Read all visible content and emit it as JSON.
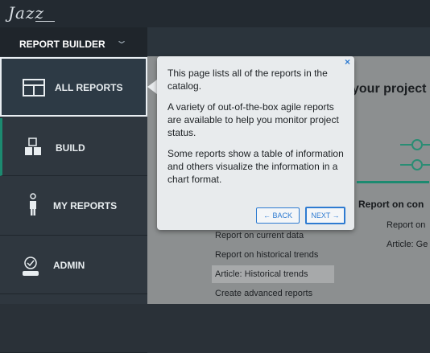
{
  "app": {
    "logo": "Jazz"
  },
  "sidebar": {
    "header": "REPORT BUILDER",
    "items": [
      {
        "label": "ALL REPORTS",
        "icon": "table-icon"
      },
      {
        "label": "BUILD",
        "icon": "blocks-icon"
      },
      {
        "label": "MY REPORTS",
        "icon": "person-icon"
      },
      {
        "label": "ADMIN",
        "icon": "admin-icon"
      }
    ]
  },
  "main": {
    "heading": "your project",
    "section_title": "Report on con",
    "right_items": [
      "Report on",
      "Article: Ge"
    ],
    "left_list": [
      "Report on current data",
      "Report on historical trends",
      "Article: Historical trends",
      "Create advanced reports"
    ]
  },
  "tooltip": {
    "close": "×",
    "p1": "This page lists all of the reports in the catalog.",
    "p2": "A variety of out-of-the-box agile reports are available to help you monitor project status.",
    "p3": "Some reports show a table of information and others visualize the information in a chart format.",
    "back": "← BACK",
    "next": "NEXT →"
  },
  "colors": {
    "accent": "#1c8a70",
    "link": "#2e7bd1"
  }
}
